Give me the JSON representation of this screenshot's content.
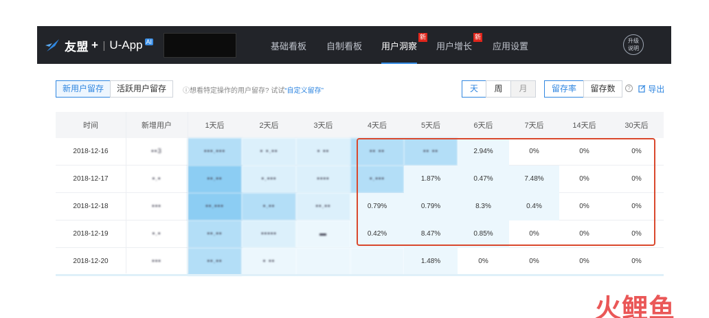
{
  "brand": {
    "name": "友盟",
    "plus": "+",
    "sep": "|",
    "app": "U-App",
    "ai": "AI"
  },
  "nav": [
    {
      "label": "基础看板",
      "active": false,
      "badge": ""
    },
    {
      "label": "自制看板",
      "active": false,
      "badge": ""
    },
    {
      "label": "用户洞察",
      "active": true,
      "badge": "新"
    },
    {
      "label": "用户增长",
      "active": false,
      "badge": "新"
    },
    {
      "label": "应用设置",
      "active": false,
      "badge": ""
    }
  ],
  "upgrade": {
    "line1": "升级",
    "line2": "说明"
  },
  "filters": {
    "new_users": "新用户留存",
    "active_users": "活跃用户留存",
    "hint_prefix": "ⓘ想看特定操作的用户留存? 试试",
    "hint_link": "“自定义留存”",
    "period": [
      "天",
      "周",
      "月"
    ],
    "metric": [
      "留存率",
      "留存数"
    ],
    "help": "?",
    "export": "导出"
  },
  "table": {
    "headers": [
      "时间",
      "新增用户",
      "1天后",
      "2天后",
      "3天后",
      "4天后",
      "5天后",
      "6天后",
      "7天后",
      "14天后",
      "30天后"
    ],
    "rows": [
      {
        "date": "2018-12-16",
        "cells": [
          "▪▪3",
          "▪▪▪.▪▪▪",
          "▪ ▪.▪▪",
          "▪ ▪▪",
          "▪▪ ▪▪",
          "▪▪ ▪▪",
          "2.94%",
          "0%",
          "0%",
          "0%"
        ]
      },
      {
        "date": "2018-12-17",
        "cells": [
          "▪.▪",
          "▪▪.▪▪",
          "▪.▪▪▪",
          "▪▪▪▪",
          "▪.▪▪▪",
          "1.87%",
          "0.47%",
          "7.48%",
          "0%",
          "0%"
        ]
      },
      {
        "date": "2018-12-18",
        "cells": [
          "▪▪▪",
          "▪▪.▪▪▪",
          "▪.▪▪",
          "▪▪.▪▪",
          "0.79%",
          "0.79%",
          "8.3%",
          "0.4%",
          "0%",
          "0%"
        ]
      },
      {
        "date": "2018-12-19",
        "cells": [
          "▪.▪",
          "▪▪.▪▪",
          "▪▪▪▪▪",
          "▬",
          "0.42%",
          "8.47%",
          "0.85%",
          "0%",
          "0%",
          "0%"
        ]
      },
      {
        "date": "2018-12-20",
        "cells": [
          "▪▪▪",
          "▪▪.▪▪",
          "▪ ▪▪",
          "",
          "",
          "1.48%",
          "0%",
          "0%",
          "0%",
          "0%"
        ]
      }
    ]
  },
  "watermark": "火鲤鱼",
  "colors": {
    "topbar": "#222429",
    "accent": "#2f86e0",
    "heat_high": "#8ccdf3",
    "heat_mid": "#b3def7",
    "heat_low": "#dcf0fb",
    "heat_faint": "#ecf7fd",
    "highlight": "#d9472b"
  }
}
